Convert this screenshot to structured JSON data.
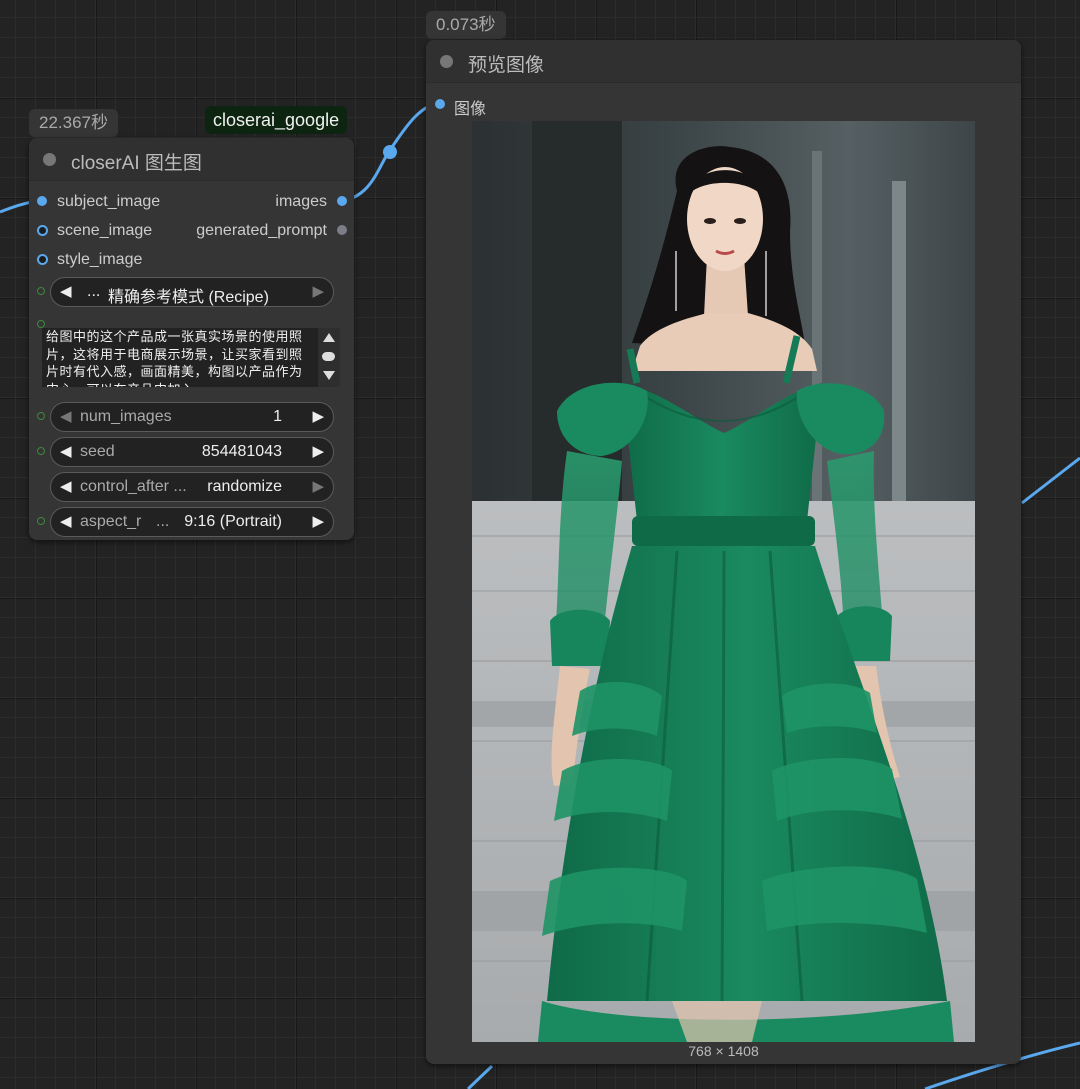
{
  "links": {
    "color": "#5aa8ee"
  },
  "badges": {
    "node1_time": "22.367秒",
    "node1_provider": "closerai_google",
    "node2_time": "0.073秒"
  },
  "node1": {
    "title": "closerAI 图生图",
    "inputs": [
      "subject_image",
      "scene_image",
      "style_image"
    ],
    "outputs": [
      "images",
      "generated_prompt"
    ],
    "mode_widget": {
      "prefix": "...",
      "value": "精确参考模式 (Recipe)"
    },
    "prompt_text": "给图中的这个产品成一张真实场景的使用照片，这将用于电商展示场景，让买家看到照片时有代入感，画面精美，构图以产品作为中心，可以在产品中加入",
    "widgets": {
      "num_images": {
        "name": "num_images",
        "value": "1"
      },
      "seed": {
        "name": "seed",
        "value": "854481043"
      },
      "control_after": {
        "name": "control_after ...",
        "value": "randomize"
      },
      "aspect": {
        "name": "aspect_r",
        "ellipsis": "...",
        "value": "9:16 (Portrait)"
      }
    }
  },
  "node2": {
    "title": "预览图像",
    "input": "图像",
    "image_dims": "768 × 1408"
  }
}
